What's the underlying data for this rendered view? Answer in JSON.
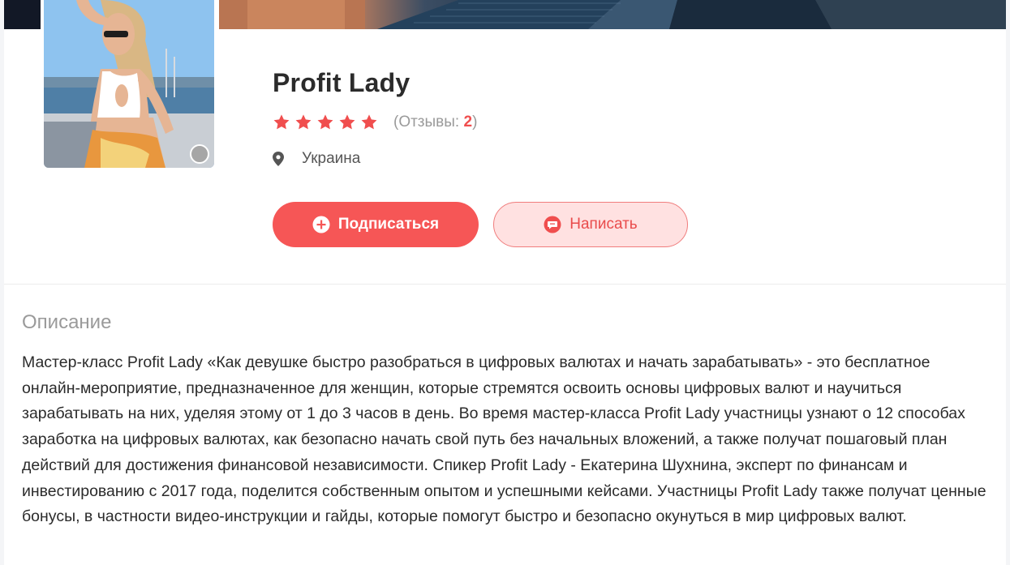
{
  "profile": {
    "name": "Profit Lady",
    "rating": 5,
    "rating_max": 5,
    "reviews_label": "(Отзывы: ",
    "reviews_count": "2",
    "reviews_suffix": ")",
    "location": "Украина",
    "status": "offline"
  },
  "actions": {
    "subscribe_label": "Подписаться",
    "message_label": "Написать"
  },
  "description": {
    "title": "Описание",
    "text": "Мастер-класс Profit Lady «Как девушке быстро разобраться в цифровых валютах и начать зарабатывать» - это бесплатное онлайн-мероприятие, предназначенное для женщин, которые стремятся освоить основы цифровых валют и научиться зарабатывать на них, уделяя этому от 1 до 3 часов в день. Во время мастер-класса Profit Lady участницы узнают о 12 способах заработка на цифровых валютах, как безопасно начать свой путь без начальных вложений, а также получат пошаговый план действий для достижения финансовой независимости. Спикер Profit Lady - Екатерина Шухнина, эксперт по финансам и инвестированию с 2017 года, поделится собственным опытом и успешными кейсами. Участницы Profit Lady также получат ценные бонусы, в частности видео-инструкции и гайды, которые помогут быстро и безопасно окунуться в мир цифровых валют."
  },
  "icons": {
    "star": "star-icon",
    "location": "map-pin-icon",
    "subscribe": "plus-circle-icon",
    "message": "chat-bubble-icon"
  },
  "colors": {
    "accent": "#f65656",
    "accent_light": "#ffe1e1",
    "star": "#f04e4e",
    "muted": "#9a9a9a"
  }
}
